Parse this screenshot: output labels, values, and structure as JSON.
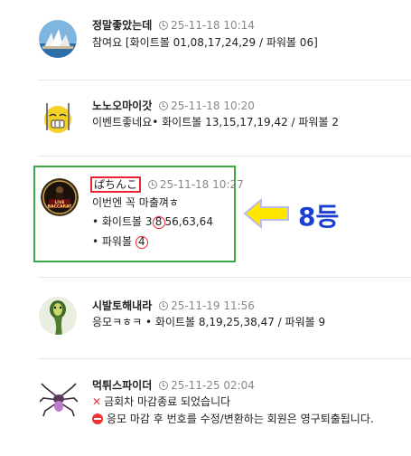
{
  "posts": [
    {
      "nick": "정말좋았는데",
      "time": "25-11-18 10:14",
      "text": "참여요 [화이트볼 01,08,17,24,29 / 파워볼 06]"
    },
    {
      "nick": "노노오마이갓",
      "time": "25-11-18 10:20",
      "text": "이벤트좋네요• 화이트볼 13,15,17,19,42 / 파워볼 2"
    },
    {
      "nick": "ぱちんこ",
      "time": "25-11-18 10:27",
      "text": "이번엔 꼭 마출껴ㅎ",
      "white_prefix": "• 화이트볼 3",
      "white_circled": "8",
      "white_rest": "56,63,64",
      "power_prefix": "• 파워볼 ",
      "power_circled": "4",
      "avatar_text_top": "LIVE",
      "avatar_text_bottom": "BACCARAT"
    },
    {
      "nick": "시발토해내라",
      "time": "25-11-19 11:56",
      "text": "응모ㅋㅎㅋ • 화이트볼 8,19,25,38,47 / 파워볼 9"
    },
    {
      "nick": "먹튀스파이더",
      "time": "25-11-25 02:04",
      "text1": "금회차 마감종료 되었습니다",
      "text2": "응모 마감 후 번호를 수정/변환하는 회원은 영구퇴출됩니다."
    }
  ],
  "annotation": {
    "label": "8등",
    "arrow_color": "#ffe600",
    "box_color": "#3aa845",
    "label_color": "#1a3fd0"
  }
}
